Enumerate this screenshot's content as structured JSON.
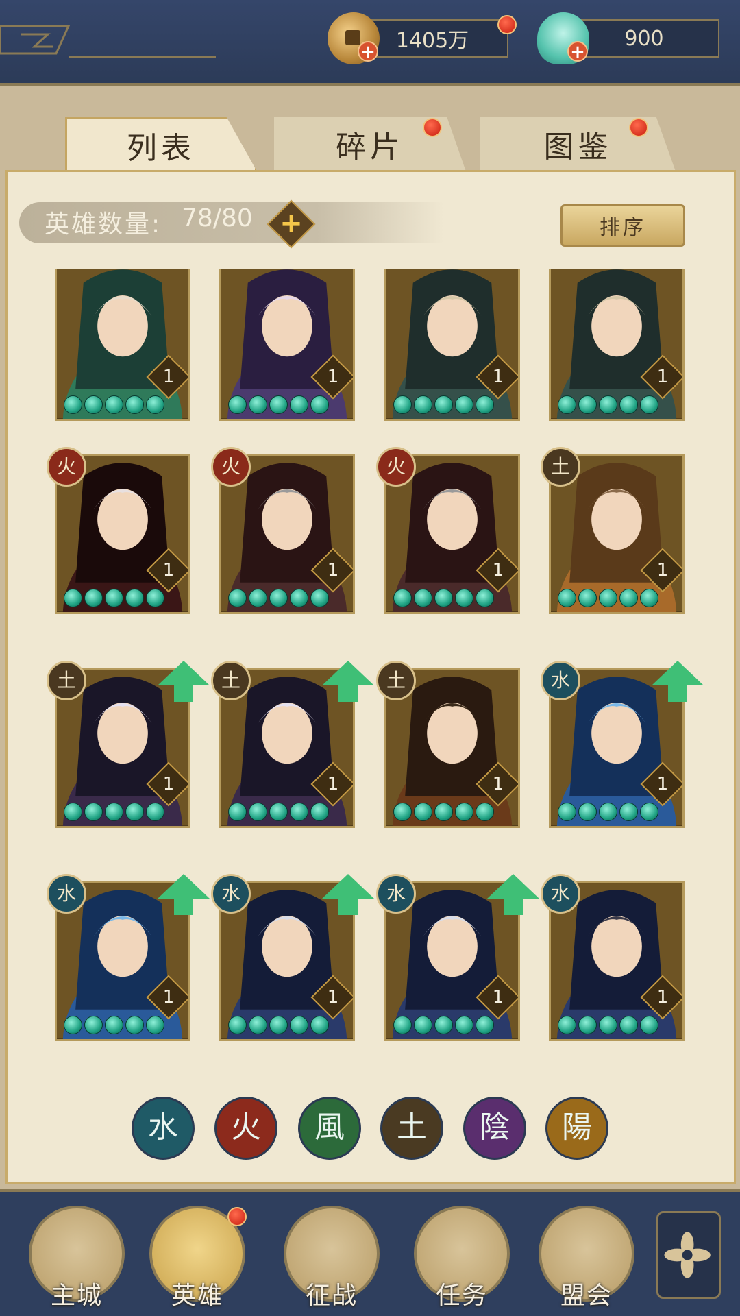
{
  "resources": {
    "coins": {
      "value": "1405万"
    },
    "shells": {
      "value": "900"
    }
  },
  "tabs": [
    {
      "label": "列表",
      "active": true
    },
    {
      "label": "碎片",
      "active": false
    },
    {
      "label": "图鉴",
      "active": false
    }
  ],
  "hero_count": {
    "label": "英雄数量:",
    "value": "78/80"
  },
  "sort_button": {
    "label": "排序"
  },
  "heroes": [
    {
      "level": "1",
      "element": "",
      "upgrade": false,
      "stars": 5
    },
    {
      "level": "1",
      "element": "",
      "upgrade": false,
      "stars": 5
    },
    {
      "level": "1",
      "element": "",
      "upgrade": false,
      "stars": 5
    },
    {
      "level": "1",
      "element": "",
      "upgrade": false,
      "stars": 5
    },
    {
      "level": "1",
      "element": "火",
      "upgrade": false,
      "stars": 5
    },
    {
      "level": "1",
      "element": "火",
      "upgrade": false,
      "stars": 5
    },
    {
      "level": "1",
      "element": "火",
      "upgrade": false,
      "stars": 5
    },
    {
      "level": "1",
      "element": "土",
      "upgrade": false,
      "stars": 5
    },
    {
      "level": "1",
      "element": "土",
      "upgrade": true,
      "stars": 5
    },
    {
      "level": "1",
      "element": "土",
      "upgrade": true,
      "stars": 5
    },
    {
      "level": "1",
      "element": "土",
      "upgrade": false,
      "stars": 5
    },
    {
      "level": "1",
      "element": "水",
      "upgrade": true,
      "stars": 5
    },
    {
      "level": "1",
      "element": "水",
      "upgrade": true,
      "stars": 5
    },
    {
      "level": "1",
      "element": "水",
      "upgrade": true,
      "stars": 5
    },
    {
      "level": "1",
      "element": "水",
      "upgrade": true,
      "stars": 5
    },
    {
      "level": "1",
      "element": "水",
      "upgrade": false,
      "stars": 5
    }
  ],
  "element_filters": [
    {
      "glyph": "水",
      "color": "#1f5a66"
    },
    {
      "glyph": "火",
      "color": "#8c2a1c"
    },
    {
      "glyph": "風",
      "color": "#2c6a3a"
    },
    {
      "glyph": "土",
      "color": "#4a3a22"
    },
    {
      "glyph": "陰",
      "color": "#5a2e6e"
    },
    {
      "glyph": "陽",
      "color": "#9a6a1a"
    }
  ],
  "element_colors": {
    "火": "#8a2a1a",
    "土": "#4a3820",
    "水": "#1d4f5e"
  },
  "nav": [
    {
      "label": "主城",
      "icon": "city-gate-icon"
    },
    {
      "label": "英雄",
      "icon": "hero-portrait-icon",
      "active": true
    },
    {
      "label": "征战",
      "icon": "battle-horn-icon"
    },
    {
      "label": "任务",
      "icon": "quest-scroll-icon"
    },
    {
      "label": "盟会",
      "icon": "alliance-pavilion-icon"
    }
  ]
}
